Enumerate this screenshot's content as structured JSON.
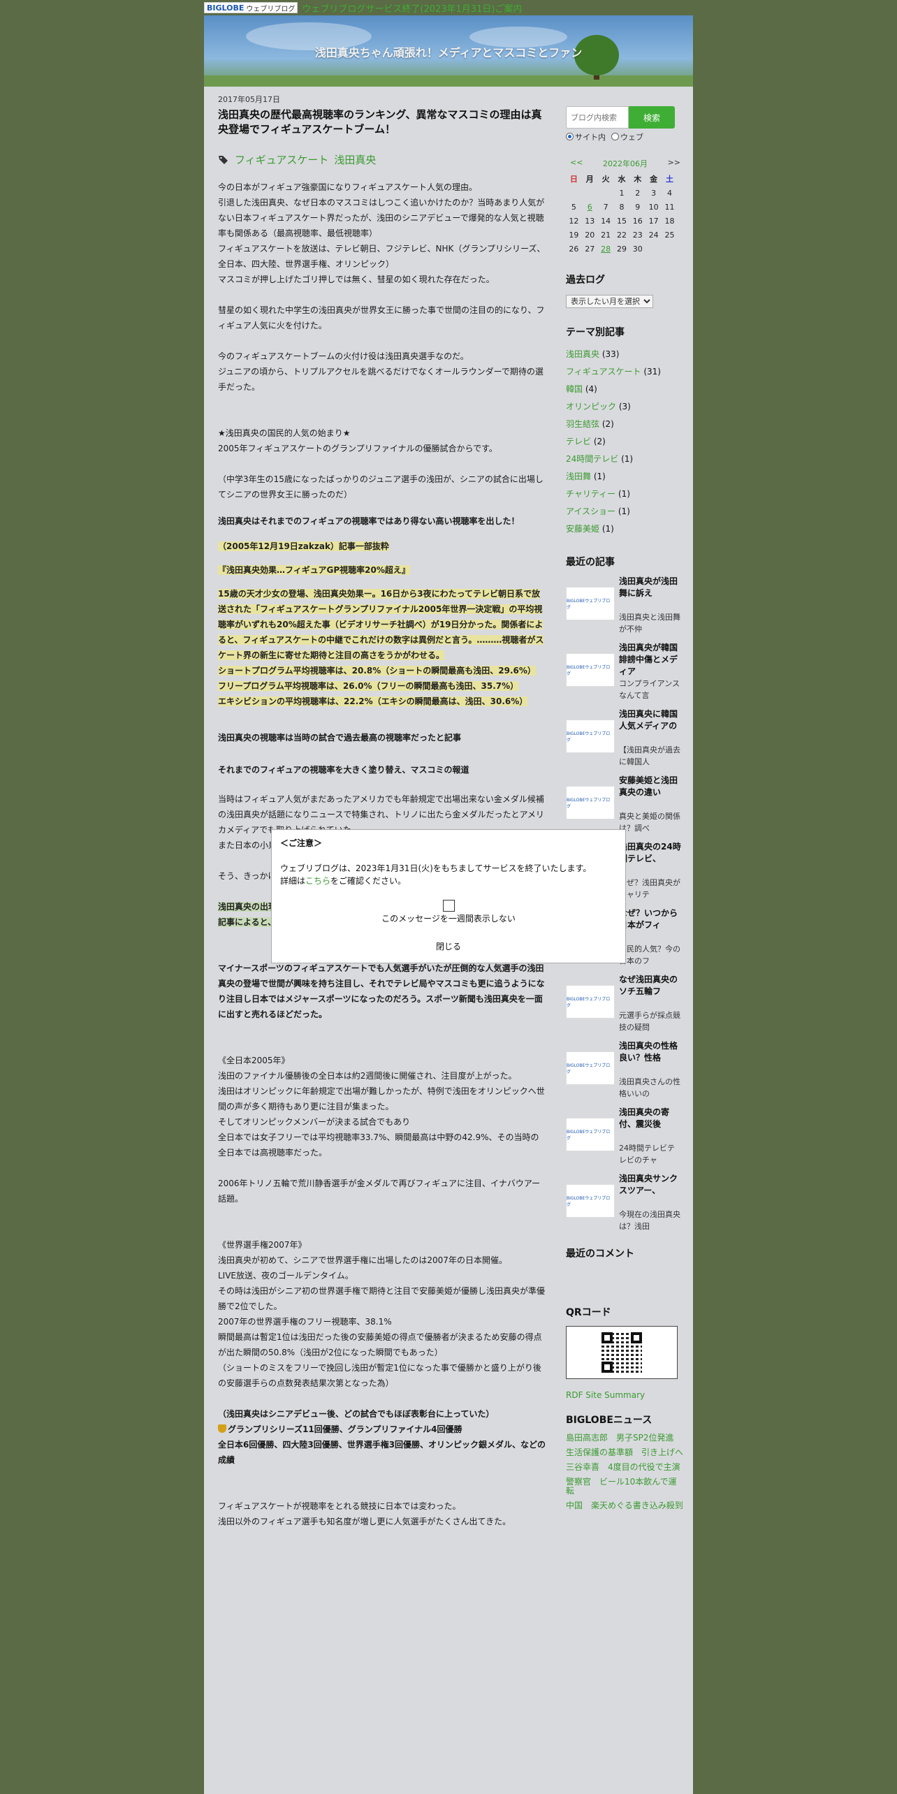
{
  "topbar": {
    "logo_text": "BIGLOBE",
    "logo_sub": "ウェブリブログ",
    "notice": "ウェブリブログサービス終了(2023年1月31日)ご案内"
  },
  "header": {
    "title": "浅田真央ちゃん頑張れ！メディアとマスコミとファン"
  },
  "post": {
    "date": "2017年05月17日",
    "title": "浅田真央の歴代最高視聴率のランキング、異常なマスコミの理由は真央登場でフィギュアスケートブーム！",
    "tags": [
      "フィギュアスケート",
      "浅田真央"
    ],
    "p1": [
      "今の日本がフィギュア強豪国になりフィギュアスケート人気の理由。",
      "引退した浅田真央、なぜ日本のマスコミはしつこく追いかけたのか？当時あまり人気がない日本フィギュアスケート界だったが、浅田のシニアデビューで爆発的な人気と視聴率も関係ある（最高視聴率、最低視聴率）",
      "フィギュアスケートを放送は、テレビ朝日、フジテレビ、NHK（グランプリシリーズ、全日本、四大陸、世界選手権、オリンピック）",
      "マスコミが押し上げたゴリ押しでは無く、彗星の如く現れた存在だった。"
    ],
    "p2": "彗星の如く現れた中学生の浅田真央が世界女王に勝った事で世間の注目の的になり、フィギュア人気に火を付けた。",
    "p3": [
      "今のフィギュアスケートブームの火付け役は浅田真央選手なのだ。",
      "ジュニアの頃から、トリプルアクセルを跳べるだけでなくオールラウンダーで期待の選手だった。"
    ],
    "p4": [
      "★浅田真央の国民的人気の始まり★",
      "2005年フィギュアスケートのグランプリファイナルの優勝試合からです。"
    ],
    "p5": "（中学3年生の15歳になったばっかりのジュニア選手の浅田が、シニアの試合に出場してシニアの世界女王に勝ったのだ）",
    "blue_h": "浅田真央はそれまでのフィギュアの視聴率ではあり得ない高い視聴率を出した！",
    "quote_src": "（2005年12月19日zakzak）記事一部抜粋",
    "quote_title": "『浅田真央効果…フィギュアGP視聴率20%超え』",
    "quote_body": "15歳の天才少女の登場、浅田真央効果ー。16日から3夜にわたってテレビ朝日系で放送された「フィギュアスケートグランプリファイナル2005年世界一決定戦」の平均視聴率がいずれも20%超えた事（ビデオリサーチ社調べ）が19日分かった。関係者によると、フィギュアスケートの中継でこれだけの数字は異例だと言う。………視聴者がスケート界の新生に寄せた期待と注目の高さをうかがわせる。",
    "ratings": [
      "ショートプログラム平均視聴率は、20.8%（ショートの瞬間最高も浅田、29.6%）",
      "フリープログラム平均視聴率は、26.0%（フリーの瞬間最高も浅田、35.7%）",
      "エキシビションの平均視聴率は、22.2%（エキシの瞬間最高は、浅田、30.6%）"
    ],
    "orange1": "浅田真央の視聴率は当時の試合で過去最高の視聴率だったと記事",
    "orange2": "それまでのフィギュアの視聴率を大きく塗り替え、マスコミの報道",
    "p6": [
      "当時はフィギュア人気がまだあったアメリカでも年齢規定で出場出来ない金メダル候補の浅田真央が話題になりニュースで特集され、トリノに出たら金メダルだったとアメリカメディアでも取り上げられていた。",
      "また日本の小泉首相までも「なぜ出れないのだ」と大きな発言して話題になった。"
    ],
    "p7": "そう、きっかけは浅田真央の2005年のグランプリファイナルなのだ！",
    "green": [
      "浅田真央の出現でグランプリファイナルの優勝で、フィギュアブームが始まった。",
      "記事によると、ショートフリーEXの3日間、いずれも平均視聴率20%を超えたのだ。"
    ],
    "blue2": "マイナースポーツのフィギュアスケートでも人気選手がいたが圧倒的な人気選手の浅田真央の登場で世間が興味を持ち注目し、それでテレビ局やマスコミも更に追うようになり注目し日本ではメジャースポーツになったのだろう。スポーツ新聞も浅田真央を一面に出すと売れるほどだった。",
    "p8": [
      "《全日本2005年》",
      "浅田のファイナル優勝後の全日本は約2週間後に開催され、注目度が上がった。",
      "浅田はオリンピックに年齢規定で出場が難しかったが、特例で浅田をオリンピックへ世間の声が多く期待もあり更に注目が集まった。",
      "そしてオリンピックメンバーが決まる試合でもあり",
      "全日本では女子フリーでは平均視聴率33.7%、瞬間最高は中野の42.9%、その当時の全日本では高視聴率だった。"
    ],
    "p9": "2006年トリノ五輪で荒川静香選手が金メダルで再びフィギュアに注目、イナバウアー話題。",
    "p10": [
      "《世界選手権2007年》",
      "浅田真央が初めて、シニアで世界選手権に出場したのは2007年の日本開催。",
      "LIVE放送、夜のゴールデンタイム。",
      "その時は浅田がシニア初の世界選手権で期待と注目で安藤美姫が優勝し浅田真央が準優勝で2位でした。",
      "2007年の世界選手権のフリー視聴率、38.1%",
      "瞬間最高は暫定1位は浅田だった後の安藤美姫の得点で優勝者が決まるため安藤の得点が出た瞬間の50.8%（浅田が2位になった瞬間でもあった）",
      "（ショートのミスをフリーで挽回し浅田が暫定1位になった事で優勝かと盛り上がり後の安藤選手らの点数発表結果次第となった為）"
    ],
    "blue3": [
      "（浅田真央はシニアデビュー後、どの試合でもほぼ表彰台に上っていた）",
      "グランプリシリーズ11回優勝、グランプリファイナル4回優勝",
      "全日本6回優勝、四大陸3回優勝、世界選手権3回優勝、オリンピック銀メダル、などの成績"
    ],
    "p11": [
      "フィギュアスケートが視聴率をとれる競技に日本では変わった。",
      "浅田以外のフィギュア選手も知名度が増し更に人気選手がたくさん出てきた。"
    ]
  },
  "sidebar": {
    "search_placeholder": "ブログ内検索",
    "search_button": "検索",
    "radio_site": "サイト内",
    "radio_web": "ウェブ",
    "cal_prev": "<<",
    "cal_month": "2022年06月",
    "cal_next": ">>",
    "cal_days": [
      "日",
      "月",
      "火",
      "水",
      "木",
      "金",
      "土"
    ],
    "cal_rows": [
      [
        "",
        "",
        "",
        "1",
        "2",
        "3",
        "4"
      ],
      [
        "5",
        "6",
        "7",
        "8",
        "9",
        "10",
        "11"
      ],
      [
        "12",
        "13",
        "14",
        "15",
        "16",
        "17",
        "18"
      ],
      [
        "19",
        "20",
        "21",
        "22",
        "23",
        "24",
        "25"
      ],
      [
        "26",
        "27",
        "28",
        "29",
        "30",
        "",
        ""
      ]
    ],
    "archive_title": "過去ログ",
    "archive_select": "表示したい月を選択",
    "theme_title": "テーマ別記事",
    "themes": [
      {
        "name": "浅田真央",
        "count": "(33)"
      },
      {
        "name": "フィギュアスケート",
        "count": "(31)"
      },
      {
        "name": "韓国",
        "count": "(4)"
      },
      {
        "name": "オリンピック",
        "count": "(3)"
      },
      {
        "name": "羽生結弦",
        "count": "(2)"
      },
      {
        "name": "テレビ",
        "count": "(2)"
      },
      {
        "name": "24時間テレビ",
        "count": "(1)"
      },
      {
        "name": "浅田舞",
        "count": "(1)"
      },
      {
        "name": "チャリティー",
        "count": "(1)"
      },
      {
        "name": "アイスショー",
        "count": "(1)"
      },
      {
        "name": "安藤美姫",
        "count": "(1)"
      }
    ],
    "recent_title": "最近の記事",
    "recent": [
      {
        "title": "浅田真央が浅田舞に訴え",
        "summary": "浅田真央と浅田舞が不仲"
      },
      {
        "title": "浅田真央が韓国誹謗中傷とメディア",
        "summary": "コンプライアンスなんて言"
      },
      {
        "title": "浅田真央に韓国人気メディアの",
        "summary": "【浅田真央が過去に韓国人"
      },
      {
        "title": "安藤美姫と浅田真央の違い",
        "summary": "真央と美姫の関係は？調べ"
      },
      {
        "title": "浅田真央の24時間テレビ、",
        "summary": "なぜ？浅田真央がチャリテ"
      },
      {
        "title": "なぜ？いつから日本がフィ",
        "summary": "国民的人気？今の日本のフ"
      },
      {
        "title": "なぜ浅田真央のソチ五輪フ",
        "summary": "元選手らが採点競技の疑問"
      },
      {
        "title": "浅田真央の性格良い？性格",
        "summary": "浅田真央さんの性格いいの"
      },
      {
        "title": "浅田真央の寄付、震災後",
        "summary": "24時間テレビテレビのチャ"
      },
      {
        "title": "浅田真央サンクスツアー、",
        "summary": "今現在の浅田真央は？浅田"
      }
    ],
    "thumb_text": "BIGLOBEウェブリブログ",
    "comments_title": "最近のコメント",
    "qr_title": "QRコード",
    "rdf": "RDF Site Summary",
    "news_title": "BIGLOBEニュース",
    "news": [
      "島田高志郎　男子SP2位発進",
      "生活保護の基準額　引き上げへ",
      "三谷幸喜　4度目の代役で主演",
      "警察官　ビール10本飲んで運転",
      "中国　楽天めぐる書き込み殺到"
    ]
  },
  "modal": {
    "heading": "＜ご注意＞",
    "line1": "ウェブリブログは、2023年1月31日(火)をもちましてサービスを終了いたします。",
    "line2_pre": "詳細は",
    "line2_link": "こちら",
    "line2_post": "をご確認ください。",
    "checkbox_label": "このメッセージを一週間表示しない",
    "close": "閉じる"
  }
}
